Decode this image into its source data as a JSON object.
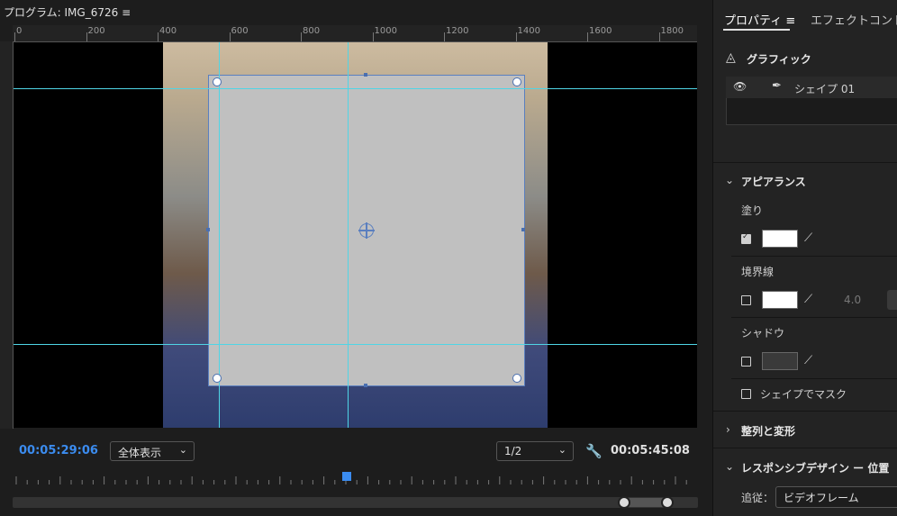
{
  "program_monitor": {
    "title": "プログラム: IMG_6726",
    "menu_icon": "hamburger-icon",
    "ruler_labels": [
      "0",
      "200",
      "400",
      "600",
      "800",
      "1000",
      "1200",
      "1400",
      "1600",
      "1800"
    ],
    "timecode_current": "00:05:29:06",
    "zoom_select": "全体表示",
    "resolution_select": "1/2",
    "timecode_duration": "00:05:45:08",
    "current_color": "#3b8cf0",
    "guide_color": "#4fd5e6",
    "shape_fill": "#c0c0c0"
  },
  "right_panel": {
    "tabs": [
      {
        "label": "プロパティ ≡",
        "active": true
      },
      {
        "label": "エフェクトコントロール",
        "active": false
      }
    ],
    "graphic_header": "グラフィック",
    "layer_name": "シェイプ 01",
    "appearance_header": "アピアランス",
    "fill_label": "塗り",
    "fill_checked": true,
    "fill_color": "#ffffff",
    "stroke_label": "境界線",
    "stroke_checked": false,
    "stroke_color": "#ffffff",
    "stroke_width": "4.0",
    "shadow_label": "シャドウ",
    "shadow_checked": false,
    "shadow_color": "#3a3a3a",
    "mask_label": "シェイプでマスク",
    "mask_checked": false,
    "align_header": "整列と変形",
    "responsive_header": "レスポンシブデザイン ー 位置",
    "follow_label": "追従：",
    "follow_value": "ビデオフレーム"
  }
}
